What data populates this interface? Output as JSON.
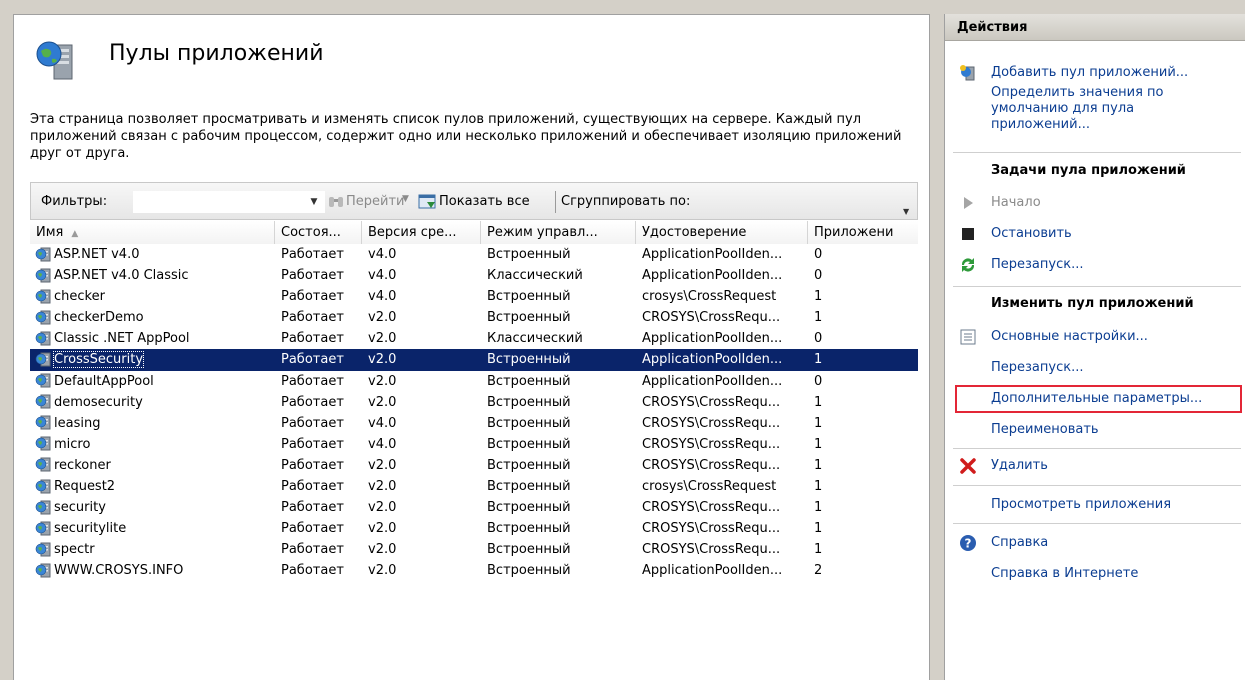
{
  "page": {
    "title": "Пулы приложений",
    "description": "Эта страница позволяет просматривать и изменять список пулов приложений, существующих на сервере. Каждый пул приложений связан с рабочим процессом, содержит одно или несколько приложений и обеспечивает изоляцию приложений друг от друга."
  },
  "toolbar": {
    "filter_label": "Фильтры:",
    "filter_value": "",
    "go_label": "Перейти",
    "show_all_label": "Показать все",
    "group_by_label": "Сгруппировать по:"
  },
  "table": {
    "columns": [
      "Имя",
      "Состоя...",
      "Версия сре...",
      "Режим управл...",
      "Удостоверение",
      "Приложени"
    ],
    "sort_indicator": "▲",
    "selected_index": 5,
    "rows": [
      [
        "ASP.NET v4.0",
        "Работает",
        "v4.0",
        "Встроенный",
        "ApplicationPoolIden...",
        "0"
      ],
      [
        "ASP.NET v4.0 Classic",
        "Работает",
        "v4.0",
        "Классический",
        "ApplicationPoolIden...",
        "0"
      ],
      [
        "checker",
        "Работает",
        "v4.0",
        "Встроенный",
        "crosys\\CrossRequest",
        "1"
      ],
      [
        "checkerDemo",
        "Работает",
        "v2.0",
        "Встроенный",
        "CROSYS\\CrossRequ...",
        "1"
      ],
      [
        "Classic .NET AppPool",
        "Работает",
        "v2.0",
        "Классический",
        "ApplicationPoolIden...",
        "0"
      ],
      [
        "CrossSecurity",
        "Работает",
        "v2.0",
        "Встроенный",
        "ApplicationPoolIden...",
        "1"
      ],
      [
        "DefaultAppPool",
        "Работает",
        "v2.0",
        "Встроенный",
        "ApplicationPoolIden...",
        "0"
      ],
      [
        "demosecurity",
        "Работает",
        "v2.0",
        "Встроенный",
        "CROSYS\\CrossRequ...",
        "1"
      ],
      [
        "leasing",
        "Работает",
        "v4.0",
        "Встроенный",
        "CROSYS\\CrossRequ...",
        "1"
      ],
      [
        "micro",
        "Работает",
        "v4.0",
        "Встроенный",
        "CROSYS\\CrossRequ...",
        "1"
      ],
      [
        "reckoner",
        "Работает",
        "v2.0",
        "Встроенный",
        "CROSYS\\CrossRequ...",
        "1"
      ],
      [
        "Request2",
        "Работает",
        "v2.0",
        "Встроенный",
        "crosys\\CrossRequest",
        "1"
      ],
      [
        "security",
        "Работает",
        "v2.0",
        "Встроенный",
        "CROSYS\\CrossRequ...",
        "1"
      ],
      [
        "securitylite",
        "Работает",
        "v2.0",
        "Встроенный",
        "CROSYS\\CrossRequ...",
        "1"
      ],
      [
        "spectr",
        "Работает",
        "v2.0",
        "Встроенный",
        "CROSYS\\CrossRequ...",
        "1"
      ],
      [
        "WWW.CROSYS.INFO",
        "Работает",
        "v2.0",
        "Встроенный",
        "ApplicationPoolIden...",
        "2"
      ]
    ]
  },
  "actions": {
    "header": "Действия",
    "add_pool": "Добавить пул приложений...",
    "set_defaults": "Определить значения по умолчанию для пула приложений...",
    "pool_tasks_title": "Задачи пула приложений",
    "start": "Начало",
    "stop": "Остановить",
    "recycle": "Перезапуск...",
    "edit_pool_title": "Изменить пул приложений",
    "basic_settings": "Основные настройки...",
    "recycling": "Перезапуск...",
    "advanced_settings": "Дополнительные параметры...",
    "rename": "Переименовать",
    "delete": "Удалить",
    "view_apps": "Просмотреть приложения",
    "help": "Справка",
    "online_help": "Справка в Интернете"
  },
  "colors": {
    "selection": "#0a246a",
    "link": "#0b3d91",
    "highlight_box": "#e32636"
  }
}
